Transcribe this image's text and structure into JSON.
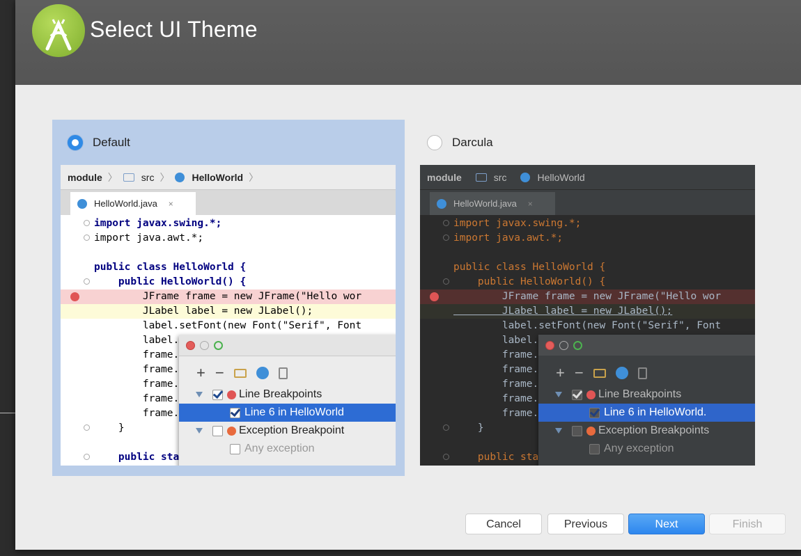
{
  "window": {
    "title": "Select UI Theme"
  },
  "themes": [
    {
      "label": "Default",
      "selected": true,
      "preview": {
        "breadcrumb": [
          "module",
          "src",
          "HelloWorld"
        ],
        "tab": {
          "label": "HelloWorld.java",
          "close": "×"
        },
        "code_lines": [
          "import javax.swing.*;",
          "import java.awt.*;",
          "",
          "public class HelloWorld {",
          "    public HelloWorld() {",
          "        JFrame frame = new JFrame(\"Hello wor",
          "        JLabel label = new JLabel();",
          "        label.setFont(new Font(\"Serif\", Font",
          "        label.",
          "        frame.",
          "        frame.",
          "        frame.",
          "        frame.",
          "        frame.",
          "    }",
          "",
          "    public sta"
        ],
        "breakpoints": {
          "toolbar": [
            "+",
            "−"
          ],
          "rows": [
            "Line Breakpoints",
            "Line 6 in HelloWorld",
            "Exception Breakpoint",
            "Any exception"
          ]
        }
      }
    },
    {
      "label": "Darcula",
      "selected": false,
      "preview": {
        "breadcrumb": [
          "module",
          "src",
          "HelloWorld"
        ],
        "tab": {
          "label": "HelloWorld.java",
          "close": "×"
        },
        "code_lines": [
          "import javax.swing.*;",
          "import java.awt.*;",
          "",
          "public class HelloWorld {",
          "    public HelloWorld() {",
          "        JFrame frame = new JFrame(\"Hello wor",
          "        JLabel label = new JLabel();",
          "        label.setFont(new Font(\"Serif\", Font",
          "        label.",
          "        frame.",
          "        frame.",
          "        frame.",
          "        frame.",
          "        frame.",
          "    }",
          "",
          "    public sta"
        ],
        "breakpoints": {
          "toolbar": [
            "+",
            "−"
          ],
          "rows": [
            "Line Breakpoints",
            "Line 6 in HelloWorld.",
            "Exception Breakpoints",
            "Any exception"
          ]
        }
      }
    }
  ],
  "footer": {
    "cancel": "Cancel",
    "previous": "Previous",
    "next": "Next",
    "finish": "Finish"
  },
  "colors": {
    "header": "#555555",
    "accent": "#2d86ee",
    "selected_panel": "#b9cde9",
    "breakpoint": "#e05555"
  },
  "icons": [
    "android-studio-logo",
    "folder-icon",
    "class-icon",
    "breakpoint-icon",
    "close-icon",
    "checkbox-icon"
  ]
}
